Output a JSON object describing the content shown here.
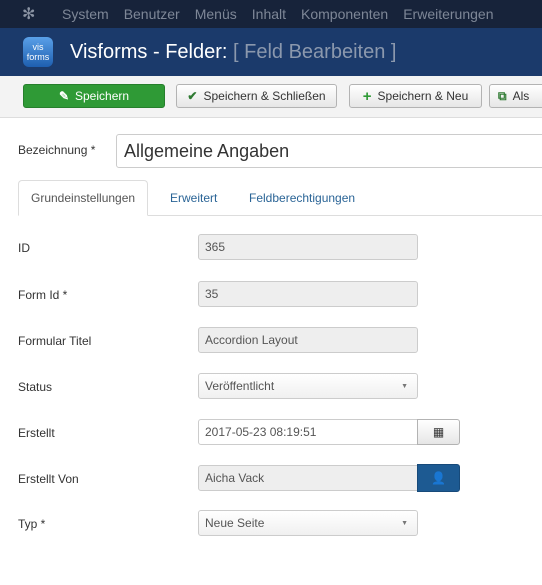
{
  "nav": {
    "items": [
      "System",
      "Benutzer",
      "Menüs",
      "Inhalt",
      "Komponenten",
      "Erweiterungen"
    ]
  },
  "header": {
    "logo_text": "vis forms",
    "title": "Visforms - Felder:",
    "subtitle": "[ Feld Bearbeiten ]"
  },
  "toolbar": {
    "save": "Speichern",
    "save_close": "Speichern & Schließen",
    "save_new": "Speichern & Neu",
    "save_copy": "Als"
  },
  "form": {
    "title_label": "Bezeichnung *",
    "title_value": "Allgemeine Angaben",
    "tabs": [
      "Grundeinstellungen",
      "Erweitert",
      "Feldberechtigungen"
    ],
    "fields": [
      {
        "label": "ID",
        "value": "365"
      },
      {
        "label": "Form Id *",
        "value": "35"
      },
      {
        "label": "Formular Titel",
        "value": "Accordion Layout"
      },
      {
        "label": "Status",
        "value": "Veröffentlicht"
      },
      {
        "label": "Erstellt",
        "value": "2017-05-23 08:19:51"
      },
      {
        "label": "Erstellt Von",
        "value": "Aicha Vack"
      },
      {
        "label": "Typ *",
        "value": "Neue Seite"
      }
    ]
  },
  "colors": {
    "nav": "#17233a",
    "header": "#1b3a6b",
    "save": "#2f9a36",
    "user_button": "#1d5a92"
  }
}
